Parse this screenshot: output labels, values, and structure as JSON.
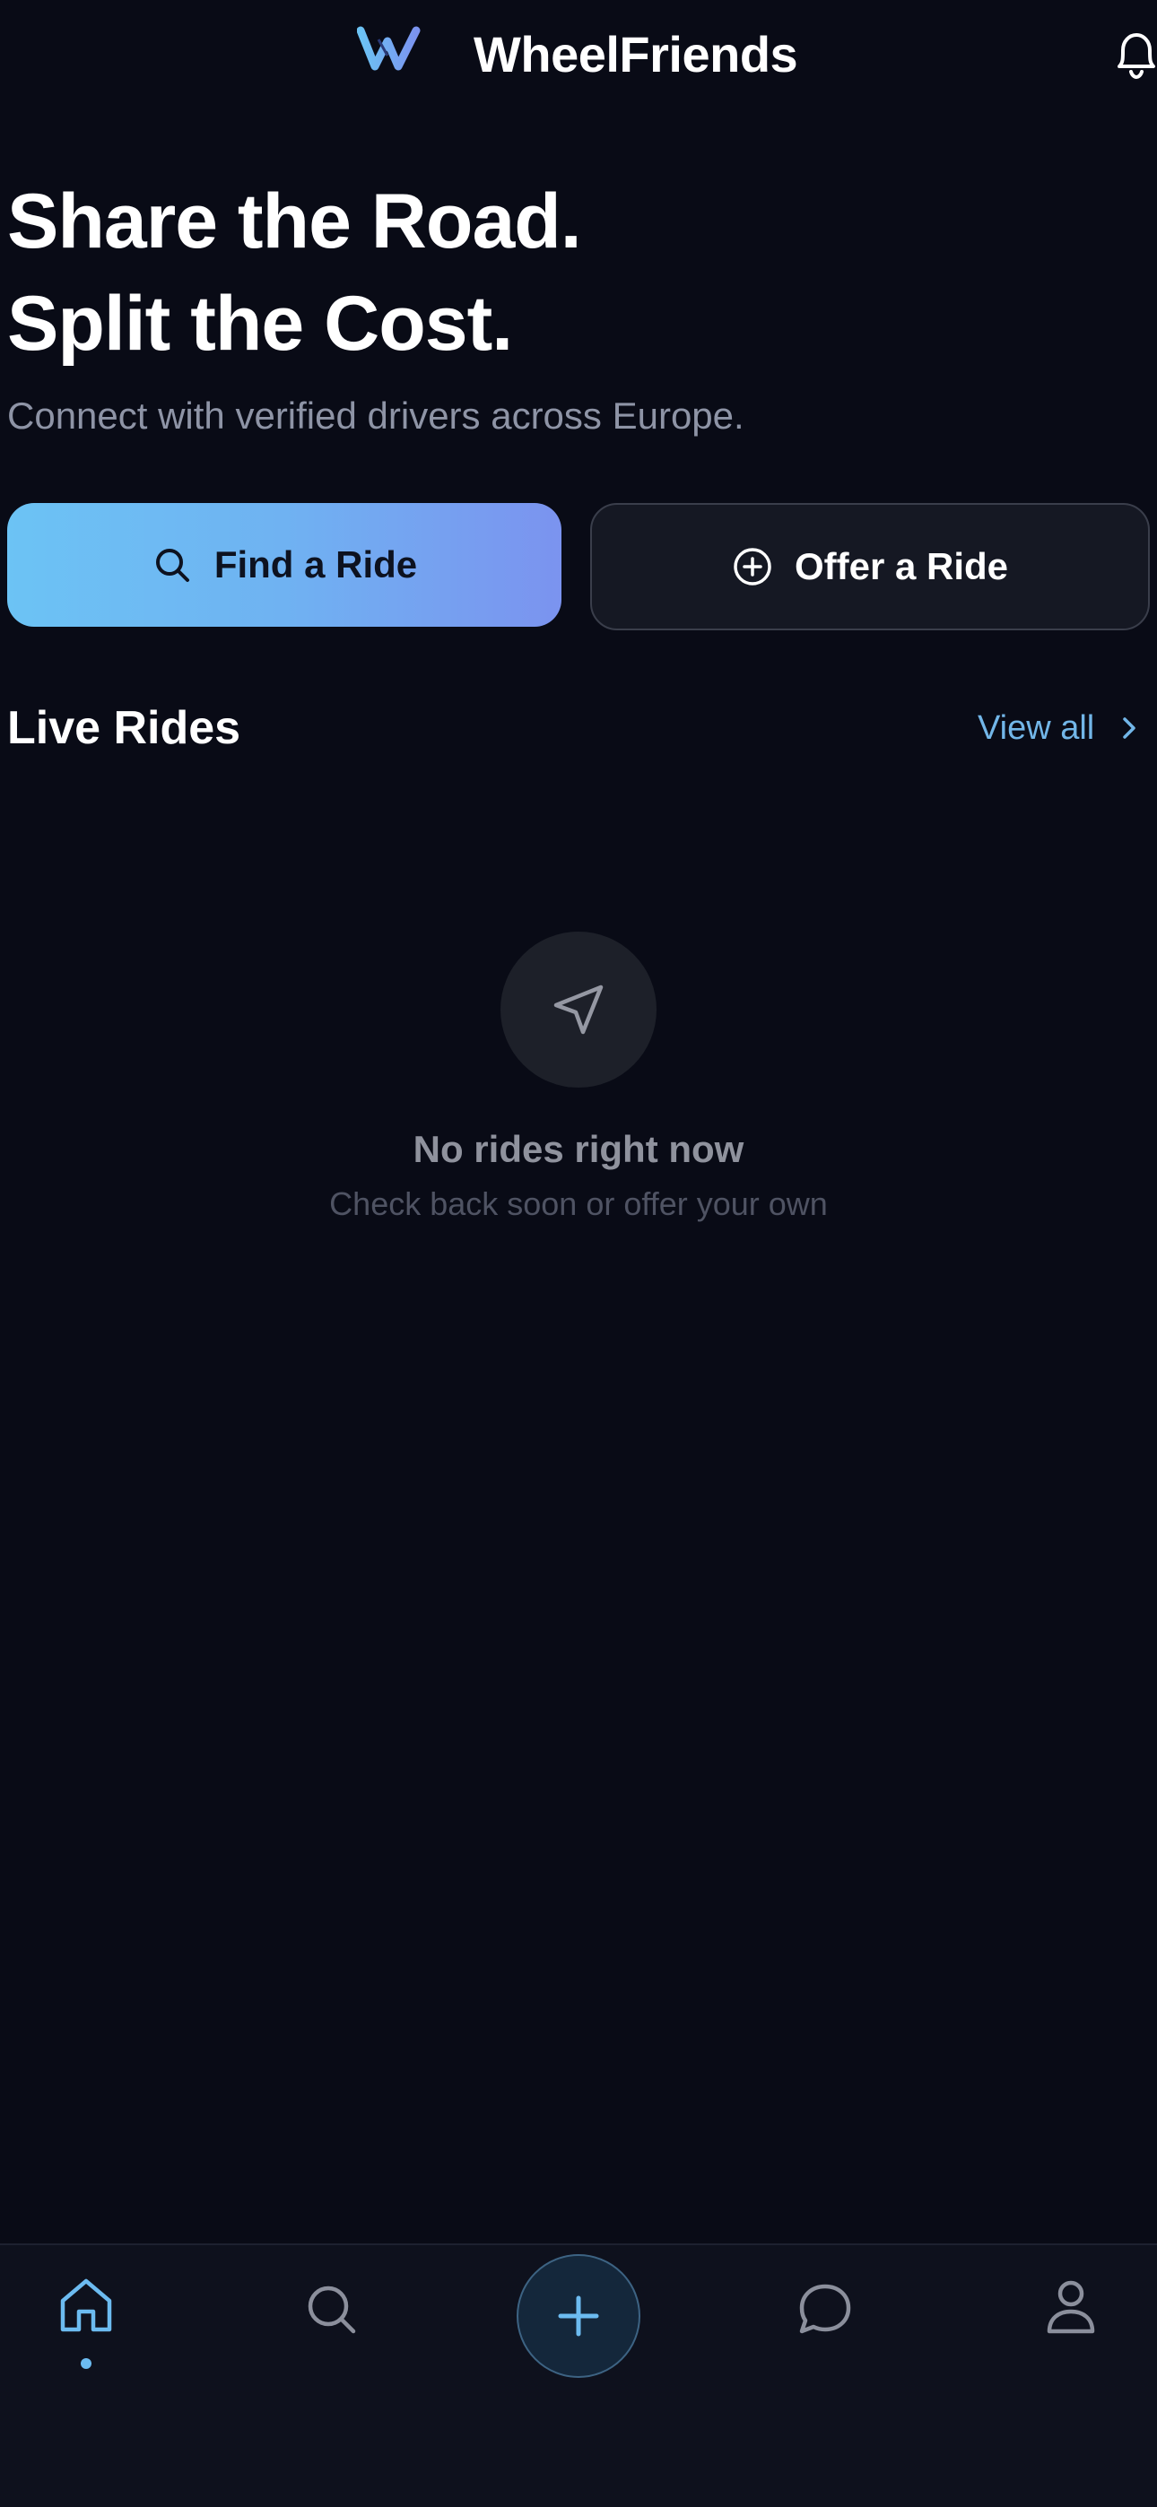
{
  "colors": {
    "background": "#090b16",
    "accent": "#6cbbf0",
    "gradient_start": "#6cc3f4",
    "gradient_end": "#7b93ef",
    "muted_text": "#8e94a6",
    "dim_text": "#4f5363",
    "link": "#72b6e8"
  },
  "header": {
    "logo_icon": "w-logo-icon",
    "title": "WheelFriends",
    "notification_icon": "bell-icon"
  },
  "hero": {
    "title_line1": "Share the Road.",
    "title_line2": "Split the Cost.",
    "subtitle": "Connect with verified drivers across Europe."
  },
  "actions": {
    "find": {
      "label": "Find a Ride",
      "icon": "search-icon"
    },
    "offer": {
      "label": "Offer a Ride",
      "icon": "plus-circle-icon"
    }
  },
  "live_rides": {
    "title": "Live Rides",
    "view_all": "View all",
    "empty": {
      "icon": "navigation-arrow-icon",
      "title": "No rides right now",
      "subtitle": "Check back soon or offer your own"
    }
  },
  "bottom_nav": {
    "items": [
      {
        "name": "home",
        "icon": "home-icon",
        "active": true
      },
      {
        "name": "search",
        "icon": "search-icon",
        "active": false
      },
      {
        "name": "add",
        "icon": "plus-icon",
        "active": false
      },
      {
        "name": "messages",
        "icon": "chat-bubble-icon",
        "active": false
      },
      {
        "name": "profile",
        "icon": "user-icon",
        "active": false
      }
    ]
  }
}
